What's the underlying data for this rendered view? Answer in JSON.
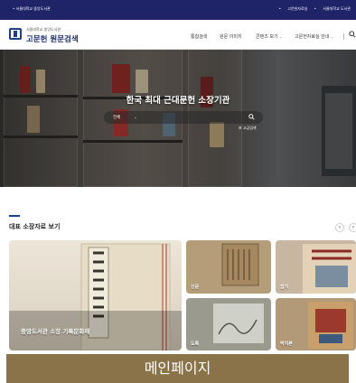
{
  "topbar": {
    "left": "서울대학교 중앙도서관",
    "right": [
      "고문헌자료실",
      "서울대학교 도서관"
    ]
  },
  "header": {
    "logo_sub": "서울대학교 중앙도서관",
    "logo_title": "고문헌 원문검색",
    "nav": [
      {
        "label": "통합검색"
      },
      {
        "label": "원문 이미지"
      },
      {
        "label": "콘텐츠 보기"
      },
      {
        "label": "고문헌자료실 안내"
      }
    ],
    "search_icon": "search-icon"
  },
  "hero": {
    "title": "한국 최대 근대문헌 소장기관",
    "search": {
      "scope": "전체",
      "scope_icon": "chevron-down-icon",
      "placeholder": "",
      "icon": "search-icon"
    },
    "advanced_link": "고급검색"
  },
  "section": {
    "title": "대표 소장자료 보기",
    "prev_icon": "chevron-left-icon",
    "next_icon": "chevron-right-icon"
  },
  "cards": {
    "featured": "중앙도서관 소장 기록문화재",
    "items": [
      "신문",
      "잡지",
      "도록",
      "딱지본"
    ]
  },
  "caption": "메인페이지",
  "colors": {
    "topbar": "#1f2367",
    "brand": "#1d3f8a",
    "caption_bg": "#8a7348"
  }
}
